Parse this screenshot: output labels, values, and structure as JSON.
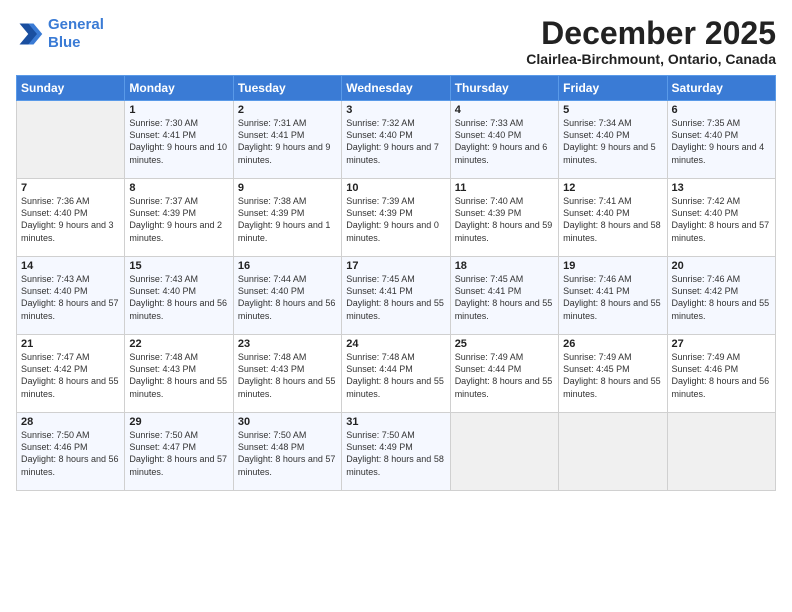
{
  "header": {
    "logo_line1": "General",
    "logo_line2": "Blue",
    "month_title": "December 2025",
    "location": "Clairlea-Birchmount, Ontario, Canada"
  },
  "weekdays": [
    "Sunday",
    "Monday",
    "Tuesday",
    "Wednesday",
    "Thursday",
    "Friday",
    "Saturday"
  ],
  "weeks": [
    [
      {
        "day": "",
        "empty": true
      },
      {
        "day": "1",
        "sunrise": "7:30 AM",
        "sunset": "4:41 PM",
        "daylight": "9 hours and 10 minutes."
      },
      {
        "day": "2",
        "sunrise": "7:31 AM",
        "sunset": "4:41 PM",
        "daylight": "9 hours and 9 minutes."
      },
      {
        "day": "3",
        "sunrise": "7:32 AM",
        "sunset": "4:40 PM",
        "daylight": "9 hours and 7 minutes."
      },
      {
        "day": "4",
        "sunrise": "7:33 AM",
        "sunset": "4:40 PM",
        "daylight": "9 hours and 6 minutes."
      },
      {
        "day": "5",
        "sunrise": "7:34 AM",
        "sunset": "4:40 PM",
        "daylight": "9 hours and 5 minutes."
      },
      {
        "day": "6",
        "sunrise": "7:35 AM",
        "sunset": "4:40 PM",
        "daylight": "9 hours and 4 minutes."
      }
    ],
    [
      {
        "day": "7",
        "sunrise": "7:36 AM",
        "sunset": "4:40 PM",
        "daylight": "9 hours and 3 minutes."
      },
      {
        "day": "8",
        "sunrise": "7:37 AM",
        "sunset": "4:39 PM",
        "daylight": "9 hours and 2 minutes."
      },
      {
        "day": "9",
        "sunrise": "7:38 AM",
        "sunset": "4:39 PM",
        "daylight": "9 hours and 1 minute."
      },
      {
        "day": "10",
        "sunrise": "7:39 AM",
        "sunset": "4:39 PM",
        "daylight": "9 hours and 0 minutes."
      },
      {
        "day": "11",
        "sunrise": "7:40 AM",
        "sunset": "4:39 PM",
        "daylight": "8 hours and 59 minutes."
      },
      {
        "day": "12",
        "sunrise": "7:41 AM",
        "sunset": "4:40 PM",
        "daylight": "8 hours and 58 minutes."
      },
      {
        "day": "13",
        "sunrise": "7:42 AM",
        "sunset": "4:40 PM",
        "daylight": "8 hours and 57 minutes."
      }
    ],
    [
      {
        "day": "14",
        "sunrise": "7:43 AM",
        "sunset": "4:40 PM",
        "daylight": "8 hours and 57 minutes."
      },
      {
        "day": "15",
        "sunrise": "7:43 AM",
        "sunset": "4:40 PM",
        "daylight": "8 hours and 56 minutes."
      },
      {
        "day": "16",
        "sunrise": "7:44 AM",
        "sunset": "4:40 PM",
        "daylight": "8 hours and 56 minutes."
      },
      {
        "day": "17",
        "sunrise": "7:45 AM",
        "sunset": "4:41 PM",
        "daylight": "8 hours and 55 minutes."
      },
      {
        "day": "18",
        "sunrise": "7:45 AM",
        "sunset": "4:41 PM",
        "daylight": "8 hours and 55 minutes."
      },
      {
        "day": "19",
        "sunrise": "7:46 AM",
        "sunset": "4:41 PM",
        "daylight": "8 hours and 55 minutes."
      },
      {
        "day": "20",
        "sunrise": "7:46 AM",
        "sunset": "4:42 PM",
        "daylight": "8 hours and 55 minutes."
      }
    ],
    [
      {
        "day": "21",
        "sunrise": "7:47 AM",
        "sunset": "4:42 PM",
        "daylight": "8 hours and 55 minutes."
      },
      {
        "day": "22",
        "sunrise": "7:48 AM",
        "sunset": "4:43 PM",
        "daylight": "8 hours and 55 minutes."
      },
      {
        "day": "23",
        "sunrise": "7:48 AM",
        "sunset": "4:43 PM",
        "daylight": "8 hours and 55 minutes."
      },
      {
        "day": "24",
        "sunrise": "7:48 AM",
        "sunset": "4:44 PM",
        "daylight": "8 hours and 55 minutes."
      },
      {
        "day": "25",
        "sunrise": "7:49 AM",
        "sunset": "4:44 PM",
        "daylight": "8 hours and 55 minutes."
      },
      {
        "day": "26",
        "sunrise": "7:49 AM",
        "sunset": "4:45 PM",
        "daylight": "8 hours and 55 minutes."
      },
      {
        "day": "27",
        "sunrise": "7:49 AM",
        "sunset": "4:46 PM",
        "daylight": "8 hours and 56 minutes."
      }
    ],
    [
      {
        "day": "28",
        "sunrise": "7:50 AM",
        "sunset": "4:46 PM",
        "daylight": "8 hours and 56 minutes."
      },
      {
        "day": "29",
        "sunrise": "7:50 AM",
        "sunset": "4:47 PM",
        "daylight": "8 hours and 57 minutes."
      },
      {
        "day": "30",
        "sunrise": "7:50 AM",
        "sunset": "4:48 PM",
        "daylight": "8 hours and 57 minutes."
      },
      {
        "day": "31",
        "sunrise": "7:50 AM",
        "sunset": "4:49 PM",
        "daylight": "8 hours and 58 minutes."
      },
      {
        "day": "",
        "empty": true
      },
      {
        "day": "",
        "empty": true
      },
      {
        "day": "",
        "empty": true
      }
    ]
  ]
}
